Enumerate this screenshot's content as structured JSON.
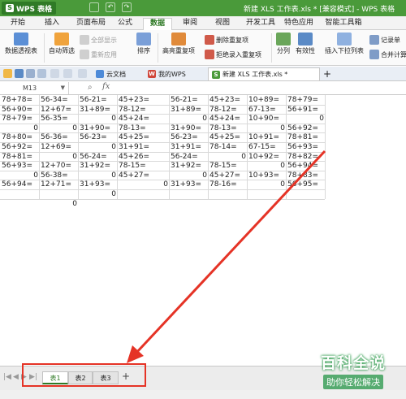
{
  "titlebar": {
    "app_name": "WPS 表格",
    "app_logo": "S",
    "window_title": "新建 XLS 工作表.xls * [兼容模式] - WPS 表格"
  },
  "ribbon_tabs": [
    "开始",
    "插入",
    "页面布局",
    "公式",
    "数据",
    "审阅",
    "视图",
    "开发工具",
    "特色应用",
    "智能工具箱"
  ],
  "ribbon_active_tab": "数据",
  "ribbon": {
    "pivot": "数据透视表",
    "autofilter": "自动筛选",
    "show_all": "全部显示",
    "reapply": "重新应用",
    "sort": "排序",
    "highlight_dup": "高亮重复项",
    "remove_dup": "删除重复项",
    "reject_dup": "拒绝录入重复项",
    "split": "分列",
    "validity": "有效性",
    "insert_dropdown": "插入下拉列表",
    "record_form": "记录单",
    "merge_calc": "合并计算"
  },
  "doc_tabs": [
    "云文档",
    "我的WPS",
    "新建 XLS 工作表.xls *"
  ],
  "formula_bar": {
    "name_box": "M13",
    "fx": "fx",
    "content": ""
  },
  "cells": [
    {
      "row": 0,
      "col": 0,
      "text": "78+78=",
      "align": "l"
    },
    {
      "row": 0,
      "col": 1,
      "text": "56-34=",
      "align": "l"
    },
    {
      "row": 0,
      "col": 2,
      "text": "56-21=",
      "align": "l"
    },
    {
      "row": 0,
      "col": 3,
      "text": "45+23=",
      "align": "l"
    },
    {
      "row": 0,
      "col": 4,
      "text": "56-21=",
      "align": "l"
    },
    {
      "row": 0,
      "col": 5,
      "text": "45+23=",
      "align": "l"
    },
    {
      "row": 0,
      "col": 6,
      "text": "10+89=",
      "align": "l"
    },
    {
      "row": 0,
      "col": 7,
      "text": "78+79=",
      "align": "l"
    },
    {
      "row": 1,
      "col": 0,
      "text": "56+90=",
      "align": "l"
    },
    {
      "row": 1,
      "col": 1,
      "text": "12+67=",
      "align": "l"
    },
    {
      "row": 1,
      "col": 2,
      "text": "31+89=",
      "align": "l"
    },
    {
      "row": 1,
      "col": 3,
      "text": "78-12=",
      "align": "l"
    },
    {
      "row": 1,
      "col": 4,
      "text": "31+89=",
      "align": "l"
    },
    {
      "row": 1,
      "col": 5,
      "text": "78-12=",
      "align": "l"
    },
    {
      "row": 1,
      "col": 6,
      "text": "67-13=",
      "align": "l"
    },
    {
      "row": 1,
      "col": 7,
      "text": "56+91=",
      "align": "l"
    },
    {
      "row": 2,
      "col": 0,
      "text": "78+79=",
      "align": "l"
    },
    {
      "row": 2,
      "col": 1,
      "text": "56-35=",
      "align": "l"
    },
    {
      "row": 2,
      "col": 2,
      "text": "0",
      "align": "r"
    },
    {
      "row": 2,
      "col": 3,
      "text": "45+24=",
      "align": "l"
    },
    {
      "row": 2,
      "col": 4,
      "text": "0",
      "align": "r"
    },
    {
      "row": 2,
      "col": 5,
      "text": "45+24=",
      "align": "l"
    },
    {
      "row": 2,
      "col": 6,
      "text": "10+90=",
      "align": "l"
    },
    {
      "row": 2,
      "col": 7,
      "text": "0",
      "align": "r"
    },
    {
      "row": 3,
      "col": 0,
      "text": "0",
      "align": "r"
    },
    {
      "row": 3,
      "col": 1,
      "text": "0",
      "align": "r"
    },
    {
      "row": 3,
      "col": 2,
      "text": "31+90=",
      "align": "l"
    },
    {
      "row": 3,
      "col": 3,
      "text": "78-13=",
      "align": "l"
    },
    {
      "row": 3,
      "col": 4,
      "text": "31+90=",
      "align": "l"
    },
    {
      "row": 3,
      "col": 5,
      "text": "78-13=",
      "align": "l"
    },
    {
      "row": 3,
      "col": 6,
      "text": "0",
      "align": "r"
    },
    {
      "row": 3,
      "col": 7,
      "text": "56+92=",
      "align": "l"
    },
    {
      "row": 4,
      "col": 0,
      "text": "78+80=",
      "align": "l"
    },
    {
      "row": 4,
      "col": 1,
      "text": "56-36=",
      "align": "l"
    },
    {
      "row": 4,
      "col": 2,
      "text": "56-23=",
      "align": "l"
    },
    {
      "row": 4,
      "col": 3,
      "text": "45+25=",
      "align": "l"
    },
    {
      "row": 4,
      "col": 4,
      "text": "56-23=",
      "align": "l"
    },
    {
      "row": 4,
      "col": 5,
      "text": "45+25=",
      "align": "l"
    },
    {
      "row": 4,
      "col": 6,
      "text": "10+91=",
      "align": "l"
    },
    {
      "row": 4,
      "col": 7,
      "text": "78+81=",
      "align": "l"
    },
    {
      "row": 5,
      "col": 0,
      "text": "56+92=",
      "align": "l"
    },
    {
      "row": 5,
      "col": 1,
      "text": "12+69=",
      "align": "l"
    },
    {
      "row": 5,
      "col": 2,
      "text": "0",
      "align": "r"
    },
    {
      "row": 5,
      "col": 3,
      "text": "31+91=",
      "align": "l"
    },
    {
      "row": 5,
      "col": 4,
      "text": "31+91=",
      "align": "l"
    },
    {
      "row": 5,
      "col": 5,
      "text": "78-14=",
      "align": "l"
    },
    {
      "row": 5,
      "col": 6,
      "text": "67-15=",
      "align": "l"
    },
    {
      "row": 5,
      "col": 7,
      "text": "56+93=",
      "align": "l"
    },
    {
      "row": 6,
      "col": 0,
      "text": "78+81=",
      "align": "l"
    },
    {
      "row": 6,
      "col": 1,
      "text": "0",
      "align": "r"
    },
    {
      "row": 6,
      "col": 2,
      "text": "56-24=",
      "align": "l"
    },
    {
      "row": 6,
      "col": 3,
      "text": "45+26=",
      "align": "l"
    },
    {
      "row": 6,
      "col": 4,
      "text": "56-24=",
      "align": "l"
    },
    {
      "row": 6,
      "col": 5,
      "text": "0",
      "align": "r"
    },
    {
      "row": 6,
      "col": 6,
      "text": "10+92=",
      "align": "l"
    },
    {
      "row": 6,
      "col": 7,
      "text": "78+82=",
      "align": "l"
    },
    {
      "row": 7,
      "col": 0,
      "text": "56+93=",
      "align": "l"
    },
    {
      "row": 7,
      "col": 1,
      "text": "12+70=",
      "align": "l"
    },
    {
      "row": 7,
      "col": 2,
      "text": "31+92=",
      "align": "l"
    },
    {
      "row": 7,
      "col": 3,
      "text": "78-15=",
      "align": "l"
    },
    {
      "row": 7,
      "col": 4,
      "text": "31+92=",
      "align": "l"
    },
    {
      "row": 7,
      "col": 5,
      "text": "78-15=",
      "align": "l"
    },
    {
      "row": 7,
      "col": 6,
      "text": "0",
      "align": "r"
    },
    {
      "row": 7,
      "col": 7,
      "text": "56+94=",
      "align": "l"
    },
    {
      "row": 8,
      "col": 0,
      "text": "0",
      "align": "r"
    },
    {
      "row": 8,
      "col": 1,
      "text": "56-38=",
      "align": "l"
    },
    {
      "row": 8,
      "col": 2,
      "text": "0",
      "align": "r"
    },
    {
      "row": 8,
      "col": 3,
      "text": "45+27=",
      "align": "l"
    },
    {
      "row": 8,
      "col": 4,
      "text": "0",
      "align": "r"
    },
    {
      "row": 8,
      "col": 5,
      "text": "45+27=",
      "align": "l"
    },
    {
      "row": 8,
      "col": 6,
      "text": "10+93=",
      "align": "l"
    },
    {
      "row": 8,
      "col": 7,
      "text": "78+83=",
      "align": "l"
    },
    {
      "row": 9,
      "col": 0,
      "text": "56+94=",
      "align": "l"
    },
    {
      "row": 9,
      "col": 1,
      "text": "12+71=",
      "align": "l"
    },
    {
      "row": 9,
      "col": 2,
      "text": "31+93=",
      "align": "l"
    },
    {
      "row": 9,
      "col": 3,
      "text": "0",
      "align": "r"
    },
    {
      "row": 9,
      "col": 4,
      "text": "31+93=",
      "align": "l"
    },
    {
      "row": 9,
      "col": 5,
      "text": "78-16=",
      "align": "l"
    },
    {
      "row": 9,
      "col": 6,
      "text": "0",
      "align": "r"
    },
    {
      "row": 9,
      "col": 7,
      "text": "56+95=",
      "align": "l"
    },
    {
      "row": 10,
      "col": 2,
      "text": "0",
      "align": "r"
    },
    {
      "row": 11,
      "col": 1,
      "text": "0",
      "align": "r"
    }
  ],
  "sheet_tabs": [
    "表1",
    "表2",
    "表3"
  ],
  "active_sheet": "表1",
  "add_sheet": "+",
  "watermark": {
    "title": "百科全说",
    "subtitle": "助你轻松解决"
  },
  "colors": {
    "brand_green": "#4a9a3a",
    "annotation_red": "#e53326"
  }
}
